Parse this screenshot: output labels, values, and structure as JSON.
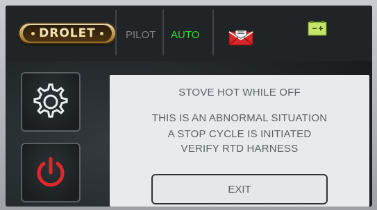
{
  "header": {
    "logo_text": "DROLET",
    "pilot_label": "PILOT",
    "auto_label": "AUTO",
    "icons": [
      "mail-alert-icon",
      "battery-icon"
    ]
  },
  "sidebar": {
    "settings_icon": "gear-icon",
    "power_icon": "power-icon"
  },
  "alert": {
    "title": "STOVE HOT WHILE OFF",
    "line1": "THIS IS AN ABNORMAL SITUATION",
    "line2": "A STOP CYCLE IS INITIATED",
    "line3": "VERIFY RTD HARNESS",
    "exit_label": "EXIT"
  },
  "colors": {
    "auto_active": "#36d83a",
    "pilot_inactive": "#7f8487",
    "power_red": "#e0282a",
    "mail_red": "#d8262a",
    "battery_green": "#c7e36a"
  }
}
